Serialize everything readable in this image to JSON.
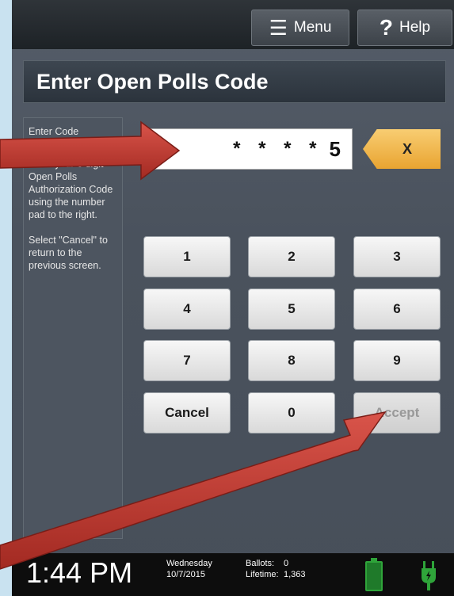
{
  "header": {
    "menu_label": "Menu",
    "help_label": "Help",
    "menu_icon": "☰",
    "help_icon": "?"
  },
  "page": {
    "title": "Enter Open Polls Code"
  },
  "instructions": {
    "heading": "Enter Code",
    "text1": "Enter your 6 digit Open Polls Authorization Code using the number pad to the right.",
    "text2": "Select \"Cancel\" to return to the previous screen."
  },
  "code_field": {
    "masked": "* * * *",
    "last_digit": "5"
  },
  "clear_label": "X",
  "keypad": {
    "keys": [
      "1",
      "2",
      "3",
      "4",
      "5",
      "6",
      "7",
      "8",
      "9"
    ],
    "cancel": "Cancel",
    "zero": "0",
    "accept": "Accept"
  },
  "status": {
    "time": "1:44 PM",
    "day": "Wednesday",
    "date": "10/7/2015",
    "ballots_label": "Ballots:",
    "ballots_value": "0",
    "lifetime_label": "Lifetime:",
    "lifetime_value": "1,363"
  },
  "colors": {
    "accent_yellow": "#f0b441",
    "arrow_red": "#c0392b",
    "battery_green": "#2fa43a"
  }
}
